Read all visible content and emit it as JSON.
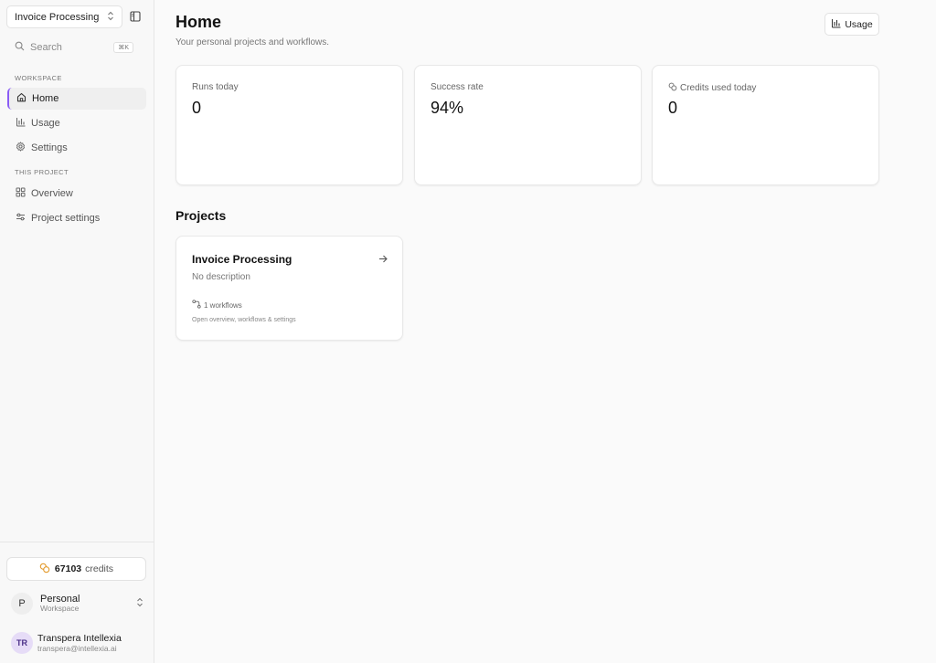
{
  "sidebar": {
    "project_selector": "Invoice Processing",
    "search": {
      "label": "Search",
      "shortcut": "⌘K"
    },
    "workspace_label": "WORKSPACE",
    "workspace_items": [
      {
        "label": "Home",
        "icon": "home-icon",
        "active": true
      },
      {
        "label": "Usage",
        "icon": "bar-chart-icon",
        "active": false
      },
      {
        "label": "Settings",
        "icon": "gear-icon",
        "active": false
      }
    ],
    "project_label": "THIS PROJECT",
    "project_items": [
      {
        "label": "Overview",
        "icon": "grid-icon"
      },
      {
        "label": "Project settings",
        "icon": "sliders-icon"
      }
    ],
    "credits": {
      "amount": "67103",
      "unit": "credits"
    },
    "workspace": {
      "initial": "P",
      "name": "Personal",
      "type": "Workspace"
    },
    "user": {
      "initials": "TR",
      "name": "Transpera Intellexia",
      "email": "transpera@intellexia.ai"
    }
  },
  "header": {
    "title": "Home",
    "subtitle": "Your personal projects and workflows.",
    "usage_button": "Usage"
  },
  "stats": [
    {
      "label": "Runs today",
      "value": "0"
    },
    {
      "label": "Success rate",
      "value": "94%"
    },
    {
      "label": "Credits used today",
      "value": "0",
      "icon": "coins-icon"
    }
  ],
  "projects": {
    "title": "Projects",
    "items": [
      {
        "name": "Invoice Processing",
        "description": "No description",
        "workflows": "1 workflows",
        "hint": "Open overview, workflows & settings"
      }
    ]
  },
  "colors": {
    "accent": "#8a5cf5",
    "coin": "#e39a2c"
  }
}
